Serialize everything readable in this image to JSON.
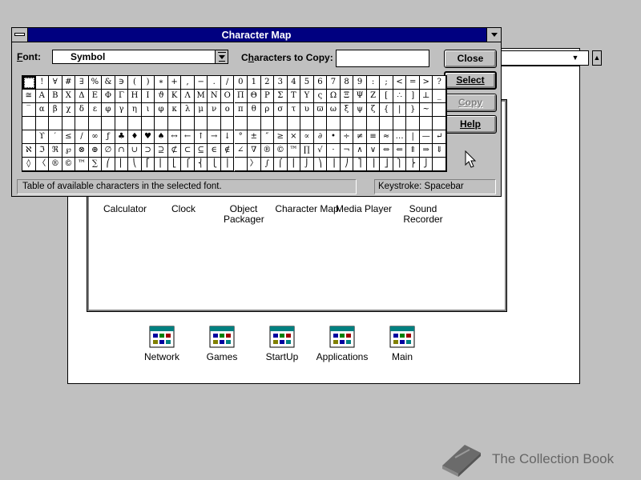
{
  "charmap": {
    "title": "Character Map",
    "font_label": "Font:",
    "font_value": "Symbol",
    "copy_label": "Characters to Copy:",
    "copy_value": "",
    "buttons": {
      "close": "Close",
      "select": "Select",
      "copy": "Copy",
      "help": "Help"
    },
    "status": "Table of available characters in the selected font.",
    "keystroke": "Keystroke: Spacebar",
    "grid_rows": [
      [
        " ",
        "!",
        "∀",
        "#",
        "∃",
        "%",
        "&",
        "∋",
        "(",
        ")",
        "∗",
        "+",
        ",",
        "−",
        ".",
        "/",
        "0",
        "1",
        "2",
        "3",
        "4",
        "5",
        "6",
        "7",
        "8",
        "9",
        ":",
        ";",
        "<",
        "=",
        ">",
        "?"
      ],
      [
        "≅",
        "Α",
        "Β",
        "Χ",
        "Δ",
        "Ε",
        "Φ",
        "Γ",
        "Η",
        "Ι",
        "ϑ",
        "Κ",
        "Λ",
        "Μ",
        "Ν",
        "Ο",
        "Π",
        "Θ",
        "Ρ",
        "Σ",
        "Τ",
        "Υ",
        "ς",
        "Ω",
        "Ξ",
        "Ψ",
        "Ζ",
        "[",
        "∴",
        "]",
        "⊥",
        "_"
      ],
      [
        "‾",
        "α",
        "β",
        "χ",
        "δ",
        "ε",
        "φ",
        "γ",
        "η",
        "ι",
        "φ",
        "κ",
        "λ",
        "μ",
        "ν",
        "ο",
        "π",
        "θ",
        "ρ",
        "σ",
        "τ",
        "υ",
        "ϖ",
        "ω",
        "ξ",
        "ψ",
        "ζ",
        "{",
        "|",
        "}",
        "~",
        ""
      ],
      [
        "",
        "",
        "",
        "",
        "",
        "",
        "",
        "",
        "",
        "",
        "",
        "",
        "",
        "",
        "",
        "",
        "",
        "",
        "",
        "",
        "",
        "",
        "",
        "",
        "",
        "",
        "",
        "",
        "",
        "",
        "",
        ""
      ],
      [
        "",
        "ϒ",
        "′",
        "≤",
        "/",
        "∞",
        "ƒ",
        "♣",
        "♦",
        "♥",
        "♠",
        "↔",
        "←",
        "↑",
        "→",
        "↓",
        "°",
        "±",
        "″",
        "≥",
        "×",
        "∝",
        "∂",
        "•",
        "÷",
        "≠",
        "≡",
        "≈",
        "…",
        "|",
        "—",
        "↵"
      ],
      [
        "ℵ",
        "ℑ",
        "ℜ",
        "℘",
        "⊗",
        "⊕",
        "∅",
        "∩",
        "∪",
        "⊃",
        "⊇",
        "⊄",
        "⊂",
        "⊆",
        "∈",
        "∉",
        "∠",
        "∇",
        "®",
        "©",
        "™",
        "∏",
        "√",
        "⋅",
        "¬",
        "∧",
        "∨",
        "⇔",
        "⇐",
        "⇑",
        "⇒",
        "⇓"
      ],
      [
        "◊",
        "〈",
        "®",
        "©",
        "™",
        "∑",
        "⎛",
        "⎜",
        "⎝",
        "⎡",
        "⎢",
        "⎣",
        "⎧",
        "⎨",
        "⎩",
        "⎪",
        "",
        "〉",
        "∫",
        "⌠",
        "⎮",
        "⌡",
        "⎞",
        "⎟",
        "⎠",
        "⎤",
        "⎥",
        "⎦",
        "⎫",
        "⎬",
        "⎭",
        ""
      ]
    ]
  },
  "progman": {
    "icons": [
      {
        "label": "Calculator"
      },
      {
        "label": "Clock"
      },
      {
        "label": "Object Packager"
      },
      {
        "label": "Character Map"
      },
      {
        "label": "Media Player"
      },
      {
        "label": "Sound Recorder"
      }
    ],
    "groups": [
      {
        "label": "Network"
      },
      {
        "label": "Games"
      },
      {
        "label": "StartUp"
      },
      {
        "label": "Applications"
      },
      {
        "label": "Main"
      }
    ]
  },
  "watermark": "The Collection Book",
  "icons": [
    "system-menu-icon",
    "minimize-arrow-icon",
    "dropdown-arrow-icon",
    "mouse-cursor-icon",
    "book-icon",
    "program-group-icon"
  ]
}
